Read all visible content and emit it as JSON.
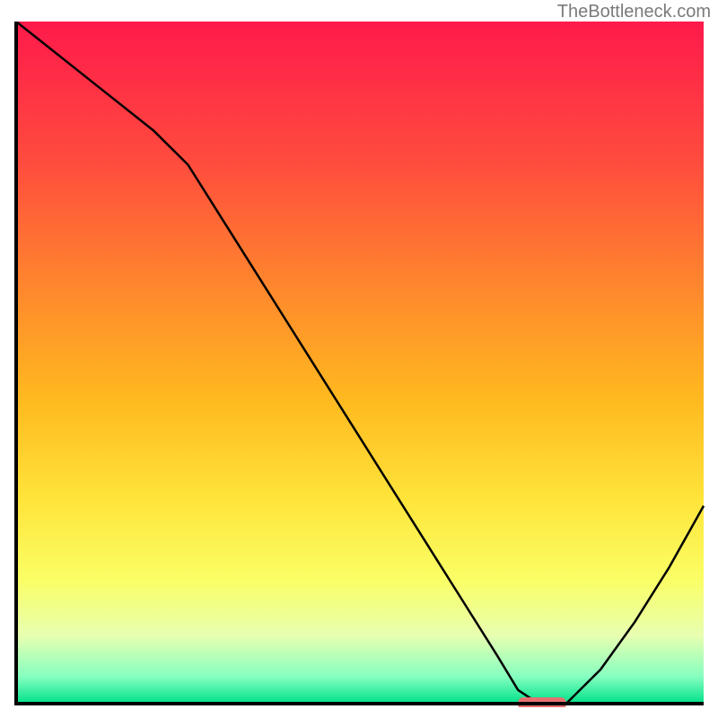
{
  "watermark": "TheBottleneck.com",
  "chart_data": {
    "type": "line",
    "title": "",
    "xlabel": "",
    "ylabel": "",
    "xlim": [
      0,
      100
    ],
    "ylim": [
      0,
      100
    ],
    "x": [
      0,
      5,
      10,
      15,
      20,
      25,
      30,
      35,
      40,
      45,
      50,
      55,
      60,
      65,
      70,
      73,
      76,
      80,
      85,
      90,
      95,
      100
    ],
    "values": [
      100,
      96,
      92,
      88,
      84,
      79,
      71,
      63,
      55,
      47,
      39,
      31,
      23,
      15,
      7,
      2,
      0,
      0,
      5,
      12,
      20,
      29
    ],
    "optimal_marker": {
      "x_start": 73,
      "x_end": 80,
      "y": 0
    },
    "gradient_stops": [
      {
        "offset": 0.0,
        "color": "#ff1a4b"
      },
      {
        "offset": 0.2,
        "color": "#ff4a3e"
      },
      {
        "offset": 0.4,
        "color": "#ff8a2c"
      },
      {
        "offset": 0.55,
        "color": "#ffb81f"
      },
      {
        "offset": 0.7,
        "color": "#ffe43a"
      },
      {
        "offset": 0.82,
        "color": "#faff66"
      },
      {
        "offset": 0.9,
        "color": "#e8ffb0"
      },
      {
        "offset": 0.96,
        "color": "#86ffc0"
      },
      {
        "offset": 1.0,
        "color": "#00e08a"
      }
    ],
    "marker_color": "#e6706f",
    "line_color": "#000000",
    "axis_color": "#000000"
  }
}
